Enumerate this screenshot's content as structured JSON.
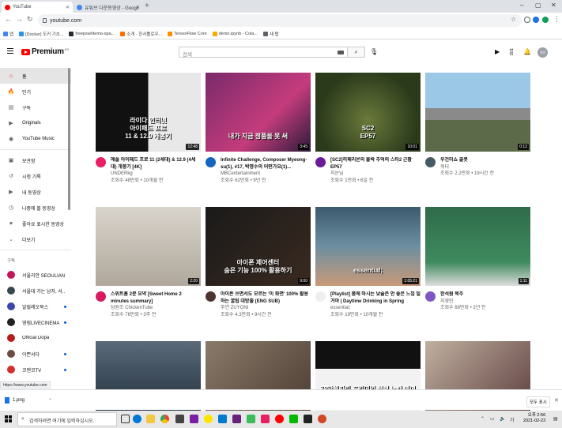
{
  "browser": {
    "tabs": [
      {
        "title": "YouTube",
        "active": true,
        "fav_color": "#ff0000"
      },
      {
        "title": "유튜브 다운동영상 - Google 검",
        "active": false,
        "fav_color": "#4285f4"
      }
    ],
    "url": "youtube.com",
    "bookmarks": [
      {
        "label": "앱",
        "color": "#4285f4"
      },
      {
        "label": "[Docker] 도커 기초...",
        "color": "#2496ed"
      },
      {
        "label": "freepsw/demo-spa...",
        "color": "#24292e"
      },
      {
        "label": "소개 · 한서툴로우...",
        "color": "#ff6f00"
      },
      {
        "label": "TensorFlow Core",
        "color": "#ff8f00"
      },
      {
        "label": "demo.ipynb - Cola...",
        "color": "#f9ab00"
      },
      {
        "label": "새 탭",
        "color": "#5f6368"
      }
    ]
  },
  "masthead": {
    "logo_word": "Premium",
    "logo_region": "KR",
    "search_placeholder": "검색",
    "avatar_label": "경민"
  },
  "sidebar": {
    "items": [
      {
        "label": "홈",
        "icon": "home-icon",
        "glyph": "⌂",
        "active": true
      },
      {
        "label": "인기",
        "icon": "trending-icon",
        "glyph": "🔥",
        "active": false
      },
      {
        "label": "구독",
        "icon": "subscriptions-icon",
        "glyph": "▤",
        "active": false
      },
      {
        "label": "Originals",
        "icon": "originals-icon",
        "glyph": "▶",
        "active": false
      },
      {
        "label": "YouTube Music",
        "icon": "music-icon",
        "glyph": "◉",
        "active": false
      }
    ],
    "library_items": [
      {
        "label": "보관함",
        "icon": "library-icon",
        "glyph": "▣"
      },
      {
        "label": "시청 기록",
        "icon": "history-icon",
        "glyph": "↺"
      },
      {
        "label": "내 동영상",
        "icon": "your-videos-icon",
        "glyph": "▶"
      },
      {
        "label": "나중에 볼 동영상",
        "icon": "watch-later-icon",
        "glyph": "◷"
      },
      {
        "label": "좋아요 표시한 동영상",
        "icon": "liked-icon",
        "glyph": "♥"
      },
      {
        "label": "더보기",
        "icon": "chevron-down-icon",
        "glyph": "⌄"
      }
    ],
    "subscriptions_heading": "구독",
    "subscriptions": [
      {
        "label": "서울리안 SEOULIAN",
        "color": "#c2185b",
        "live": false
      },
      {
        "label": "서울대 가는 남자, 서...",
        "color": "#37474f",
        "live": false
      },
      {
        "label": "알릴레오북스",
        "color": "#3949ab",
        "live": true
      },
      {
        "label": "영림LIVECINEMA",
        "color": "#212121",
        "live": true
      },
      {
        "label": "Official Dopa",
        "color": "#b71c1c",
        "live": false
      },
      {
        "label": "이쁜서다",
        "color": "#6d4c41",
        "live": true
      },
      {
        "label": "코렌코TV",
        "color": "#d32f2f",
        "live": true
      }
    ]
  },
  "videos": [
    {
      "title": "애플 아이패드 프로 11 (2세대) & 12.9 (4세대) 개봉기 [4K]",
      "channel": "UNDERkg",
      "stats": "조회수 48만회 • 10개월 전",
      "duration": "12:48",
      "av_color": "#e91e63",
      "thumb_text": "라이다 인터넷\n아이패드 프로\n11 & 12.9 개봉기"
    },
    {
      "title": "Infinite Challenge, Composer Myeong-su(1), #17, 박명수의 어떤가요(1)...",
      "channel": "MBCentertainment",
      "stats": "조회수 62만회 • 9년 전",
      "duration": "3:45",
      "av_color": "#1565c0",
      "thumb_text": "내가 지금 정품을 못 써"
    },
    {
      "title": "[SC2]히패리온의 몰락 추억의 스타2 근황 EP57",
      "channel": "지운님",
      "stats": "조회수 1만회 • 6일 전",
      "duration": "10:01",
      "av_color": "#6a1b9a",
      "thumb_text": "SC2\nEP57"
    },
    {
      "title": "우건미쇼 콜콧",
      "channel": "워터",
      "stats": "조회수 2.2만회 • 19시간 전",
      "duration": "0:12",
      "av_color": "#455a64",
      "thumb_text": ""
    },
    {
      "title": "스위트홈 2분 요약 [Sweet Home 2 minutes summary]",
      "channel": "담원조 ChickenTube",
      "stats": "조회수 76만회 • 3주 전",
      "duration": "2:20",
      "av_color": "#d81b60",
      "thumb_text": ""
    },
    {
      "title": "아이폰 쓰면서도 모르는 '이 화면' 100% 활용하는 꿀팁 대방출 (ENG SUB)",
      "channel": "주연 ZUYONI",
      "stats": "조회수 4.3만회 • 9시간 전",
      "duration": "9:00",
      "av_color": "#4e342e",
      "thumb_text": "아이폰 제어센터\n숨은 기능 100% 활용하기"
    },
    {
      "title": "[Playlist] 봄에 마시는 낮술은 안 좋은 느낌 일거야 | Daytime Drinking in Spring",
      "channel": "essential;",
      "stats": "조회수 19만회 • 10개월 전",
      "duration": "1:05:21",
      "av_color": "#eeeeee",
      "thumb_text": "essential;"
    },
    {
      "title": "한석원 목주",
      "channel": "지영민",
      "stats": "조회수 68만회 • 2년 전",
      "duration": "1:11",
      "av_color": "#7e57c2",
      "thumb_text": ""
    },
    {
      "title": "",
      "channel": "",
      "stats": "",
      "duration": "",
      "av_color": "#000",
      "thumb_text": ""
    },
    {
      "title": "",
      "channel": "",
      "stats": "",
      "duration": "",
      "av_color": "#000",
      "thumb_text": ""
    },
    {
      "title": "",
      "channel": "",
      "stats": "",
      "duration": "",
      "av_color": "#000",
      "thumb_text": "72만원짜리 프리미엄 신형 노캔 에어팟\n애플 에어팟 맥스 언박싱&첫인상"
    },
    {
      "title": "",
      "channel": "",
      "stats": "",
      "duration": "",
      "av_color": "#000",
      "thumb_text": ""
    }
  ],
  "statusbar": {
    "link": "https://www.youtube.com"
  },
  "downloads": {
    "file": "1.png",
    "show_all": "모두 표시"
  },
  "taskbar": {
    "search_placeholder": "검색하려면 여기에 입력하십시오.",
    "time": "오후 2:56",
    "date": "2021-02-23",
    "ime": "가"
  }
}
